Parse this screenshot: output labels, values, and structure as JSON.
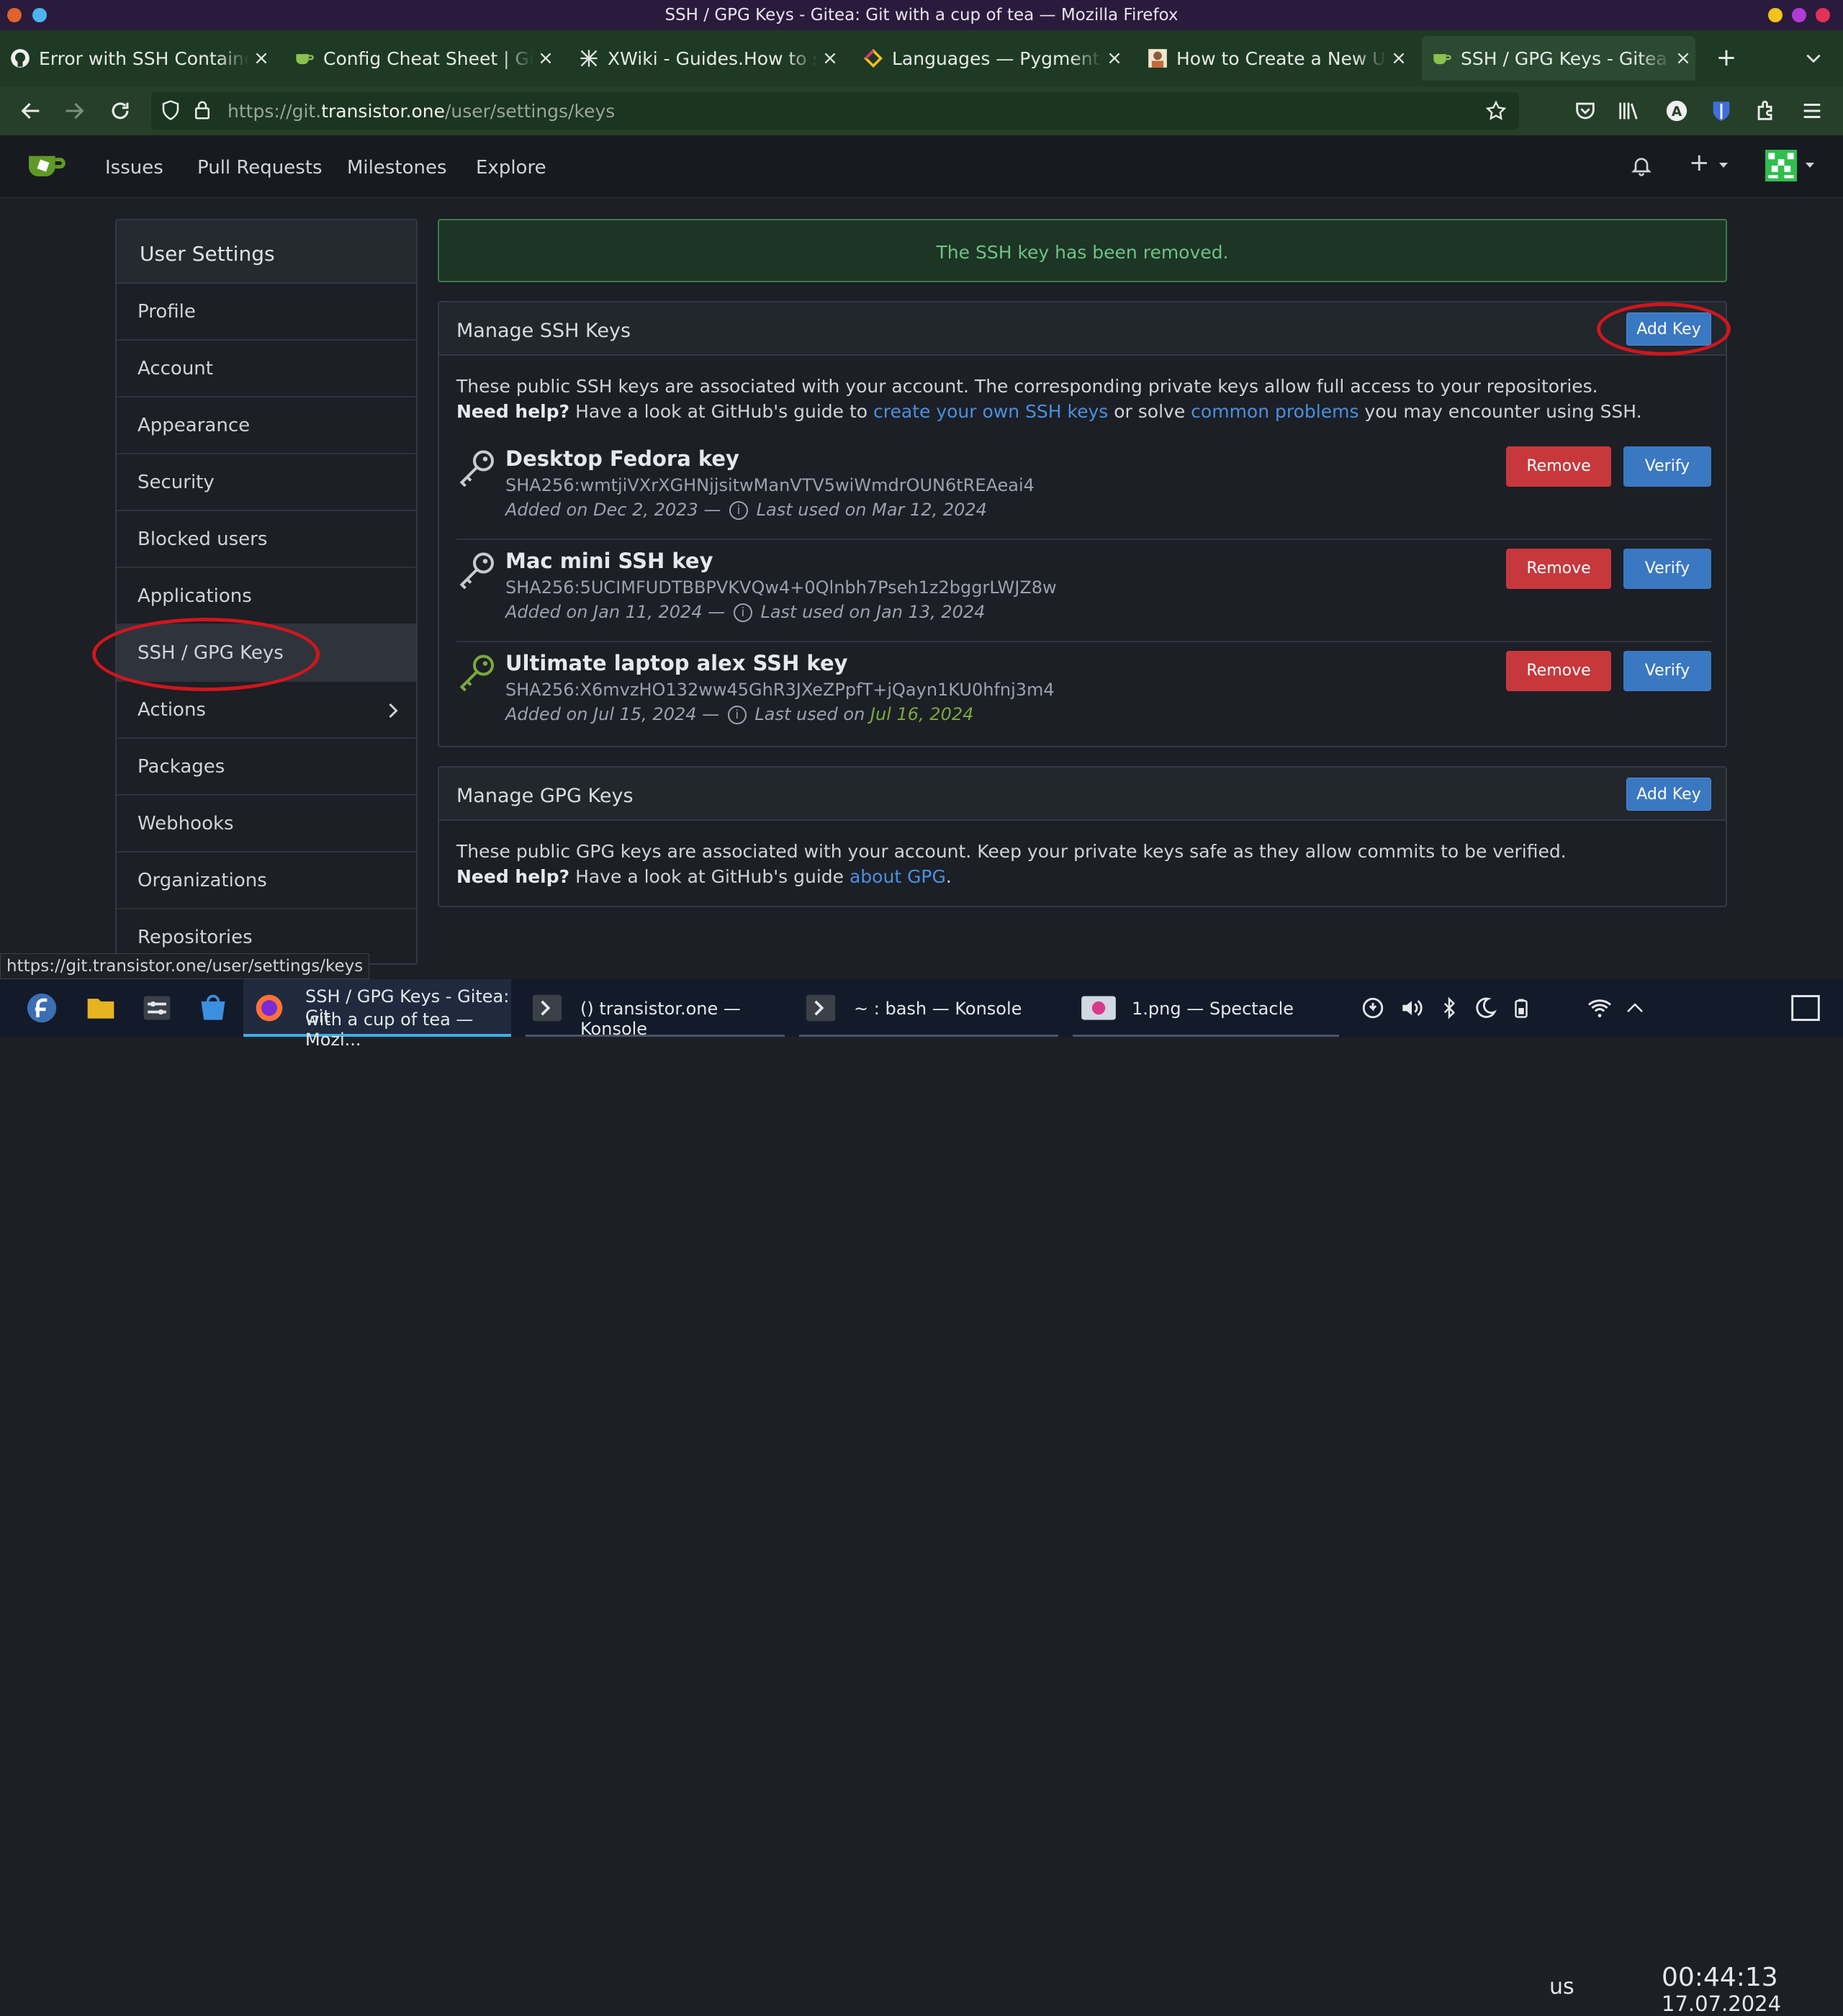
{
  "window": {
    "title": "SSH / GPG Keys - Gitea: Git with a cup of tea — Mozilla Firefox"
  },
  "tabs": [
    {
      "label": "Error with SSH Container P",
      "icon": "github-icon"
    },
    {
      "label": "Config Cheat Sheet | Gitea",
      "icon": "gitea-icon"
    },
    {
      "label": "XWiki - Guides.How to set u",
      "icon": "xwiki-icon"
    },
    {
      "label": "Languages — Pygments",
      "icon": "pygments-icon"
    },
    {
      "label": "How to Create a New User",
      "icon": "person-icon"
    },
    {
      "label": "SSH / GPG Keys - Gitea: Git",
      "icon": "gitea-icon",
      "active": true
    }
  ],
  "urlbar": {
    "prefix": "https://git.",
    "domain": "transistor.one",
    "path": "/user/settings/keys"
  },
  "gitea_nav": [
    "Issues",
    "Pull Requests",
    "Milestones",
    "Explore"
  ],
  "sidebar": {
    "title": "User Settings",
    "items": [
      "Profile",
      "Account",
      "Appearance",
      "Security",
      "Blocked users",
      "Applications",
      "SSH / GPG Keys",
      "Actions",
      "Packages",
      "Webhooks",
      "Organizations",
      "Repositories"
    ],
    "active_index": 6
  },
  "flash": "The SSH key has been removed.",
  "ssh": {
    "title": "Manage SSH Keys",
    "add_label": "Add Key",
    "desc1": "These public SSH keys are associated with your account. The corresponding private keys allow full access to your repositories.",
    "help_bold": "Need help?",
    "help_pre": " Have a look at GitHub's guide to ",
    "link1": "create your own SSH keys",
    "help_mid": " or solve ",
    "link2": "common problems",
    "help_post": " you may encounter using SSH.",
    "keys": [
      {
        "name": "Desktop Fedora key",
        "fingerprint": "SHA256:wmtjiVXrXGHNjjsitwManVTV5wiWmdrOUN6tREAeai4",
        "added": "Added on Dec 2, 2023 —",
        "last_used_label": "Last used on",
        "last_used": "Mar 12, 2024",
        "recent": false
      },
      {
        "name": "Mac mini SSH key",
        "fingerprint": "SHA256:5UCIMFUDTBBPVKVQw4+0Qlnbh7Pseh1z2bggrLWJZ8w",
        "added": "Added on Jan 11, 2024 —",
        "last_used_label": "Last used on",
        "last_used": "Jan 13, 2024",
        "recent": false
      },
      {
        "name": "Ultimate laptop alex SSH key",
        "fingerprint": "SHA256:X6mvzHO132ww45GhR3JXeZPpfT+jQayn1KU0hfnj3m4",
        "added": "Added on Jul 15, 2024 —",
        "last_used_label": "Last used on",
        "last_used": "Jul 16, 2024",
        "recent": true
      }
    ],
    "remove_label": "Remove",
    "verify_label": "Verify"
  },
  "gpg": {
    "title": "Manage GPG Keys",
    "add_label": "Add Key",
    "desc1": "These public GPG keys are associated with your account. Keep your private keys safe as they allow commits to be verified.",
    "help_bold": "Need help?",
    "help_pre": " Have a look at GitHub's guide ",
    "link": "about GPG",
    "help_post": "."
  },
  "status_link": "https://git.transistor.one/user/settings/keys",
  "taskbar": {
    "firefox_line1": "SSH / GPG Keys - Gitea: Git",
    "firefox_line2": "with a cup of tea — Mozi...",
    "konsole1": "() transistor.one — Konsole",
    "konsole2": "~ : bash — Konsole",
    "spectacle": "1.png — Spectacle",
    "keyboard": "us",
    "time": "00:44:13",
    "date": "17.07.2024"
  },
  "colors": {
    "accent_blue": "#3b78c2",
    "danger_red": "#c7383c",
    "success_green": "#6fc187",
    "annotation_red": "#d0161d"
  }
}
